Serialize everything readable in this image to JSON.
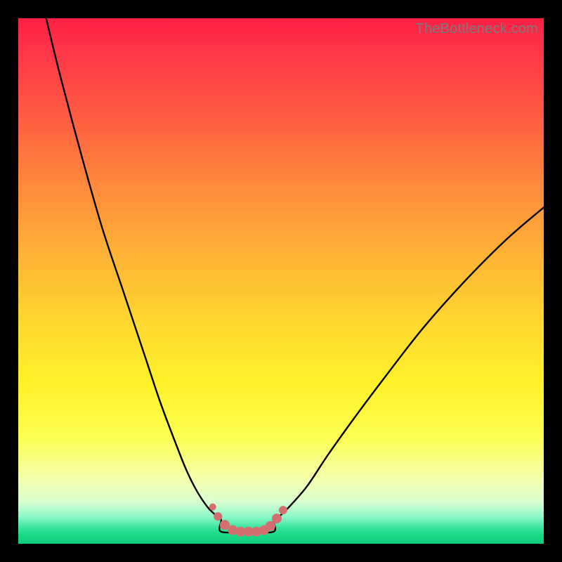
{
  "watermark": "TheBottleneck.com",
  "colors": {
    "background": "#000000",
    "curve_stroke": "#000000",
    "marker_fill": "#d46f6f",
    "marker_stroke": "#d46f6f"
  },
  "chart_data": {
    "type": "line",
    "title": "",
    "xlabel": "",
    "ylabel": "",
    "xlim": [
      0,
      100
    ],
    "ylim": [
      0,
      100
    ],
    "grid": false,
    "legend": false,
    "series": [
      {
        "name": "left-branch",
        "x": [
          5.3,
          8,
          12,
          16,
          20,
          24,
          27,
          30,
          32,
          34,
          36,
          37.5,
          38.6
        ],
        "y": [
          100,
          89,
          74,
          60,
          48,
          36,
          27,
          19,
          14,
          10,
          7,
          5.5,
          4.6
        ]
      },
      {
        "name": "right-branch",
        "x": [
          48.6,
          50,
          52,
          55,
          59,
          64,
          70,
          77,
          85,
          93,
          100
        ],
        "y": [
          4.6,
          5.5,
          7.5,
          11,
          17,
          24,
          32,
          41,
          50,
          58,
          64
        ]
      }
    ],
    "flat_segment": {
      "x_start": 38.6,
      "x_end": 48.6,
      "y": 2.3
    },
    "markers": {
      "name": "valley-markers",
      "points": [
        {
          "x": 37.0,
          "y": 7.0,
          "r": 5
        },
        {
          "x": 38.0,
          "y": 5.2,
          "r": 6
        },
        {
          "x": 39.3,
          "y": 3.6,
          "r": 7
        },
        {
          "x": 40.8,
          "y": 2.6,
          "r": 7
        },
        {
          "x": 42.3,
          "y": 2.3,
          "r": 7
        },
        {
          "x": 43.8,
          "y": 2.3,
          "r": 7
        },
        {
          "x": 45.3,
          "y": 2.3,
          "r": 7
        },
        {
          "x": 46.8,
          "y": 2.6,
          "r": 7
        },
        {
          "x": 48.0,
          "y": 3.4,
          "r": 7
        },
        {
          "x": 49.2,
          "y": 4.8,
          "r": 7
        },
        {
          "x": 50.4,
          "y": 6.4,
          "r": 6
        }
      ]
    }
  }
}
